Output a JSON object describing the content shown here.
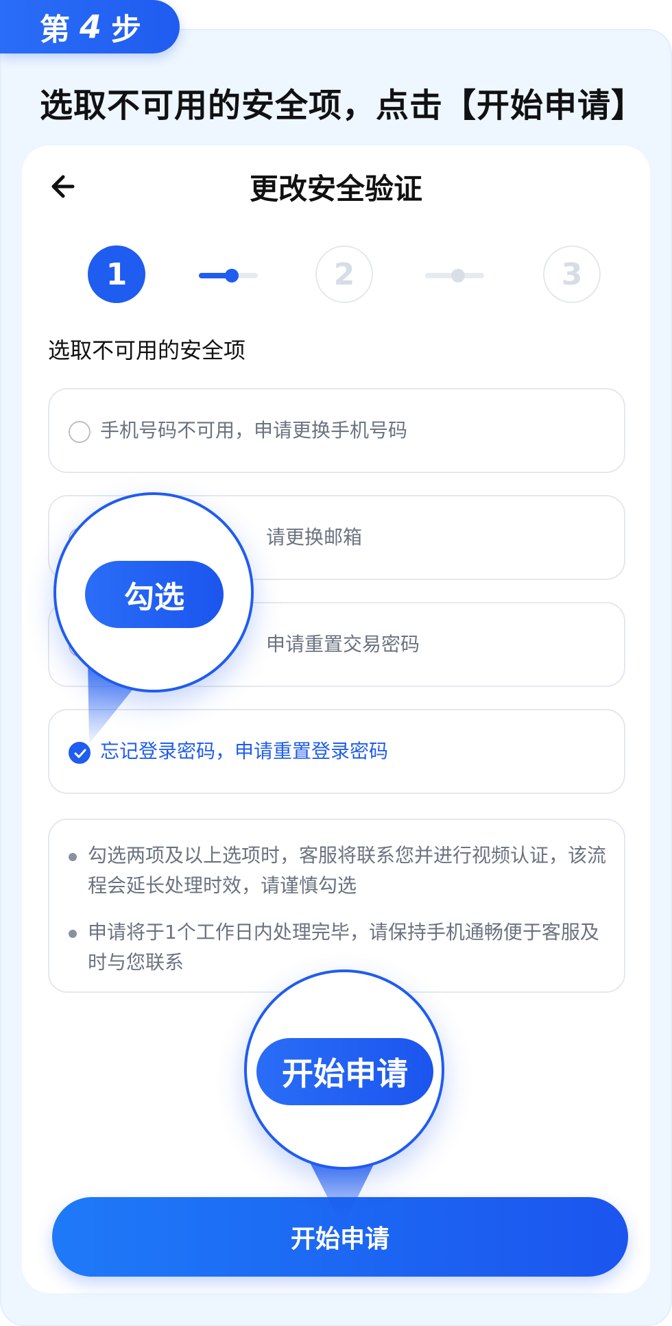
{
  "step_badge": {
    "prefix": "第",
    "number": "4",
    "suffix": "步"
  },
  "instruction": "选取不可用的安全项，点击【开始申请】",
  "screen": {
    "title": "更改安全验证",
    "back_icon": "arrow-left-icon",
    "steps": [
      "1",
      "2",
      "3"
    ],
    "current_step": 1,
    "section_label": "选取不可用的安全项",
    "options": [
      {
        "label": "手机号码不可用，申请更换手机号码",
        "checked": false
      },
      {
        "label": "请更换邮箱",
        "checked": false
      },
      {
        "label": "申请重置交易密码",
        "checked": false
      },
      {
        "label": "忘记登录密码，申请重置登录密码",
        "checked": true
      }
    ],
    "notes": [
      "勾选两项及以上选项时，客服将联系您并进行视频认证，该流程会延长处理时效，请谨慎勾选",
      "申请将于1个工作日内处理完毕，请保持手机通畅便于客服及时与您联系"
    ],
    "primary_button": "开始申请"
  },
  "callouts": {
    "check_label": "勾选",
    "apply_label": "开始申请"
  },
  "colors": {
    "accent": "#1f5cf0",
    "page_bg": "#eef6ff",
    "text_muted": "#6b7280"
  }
}
